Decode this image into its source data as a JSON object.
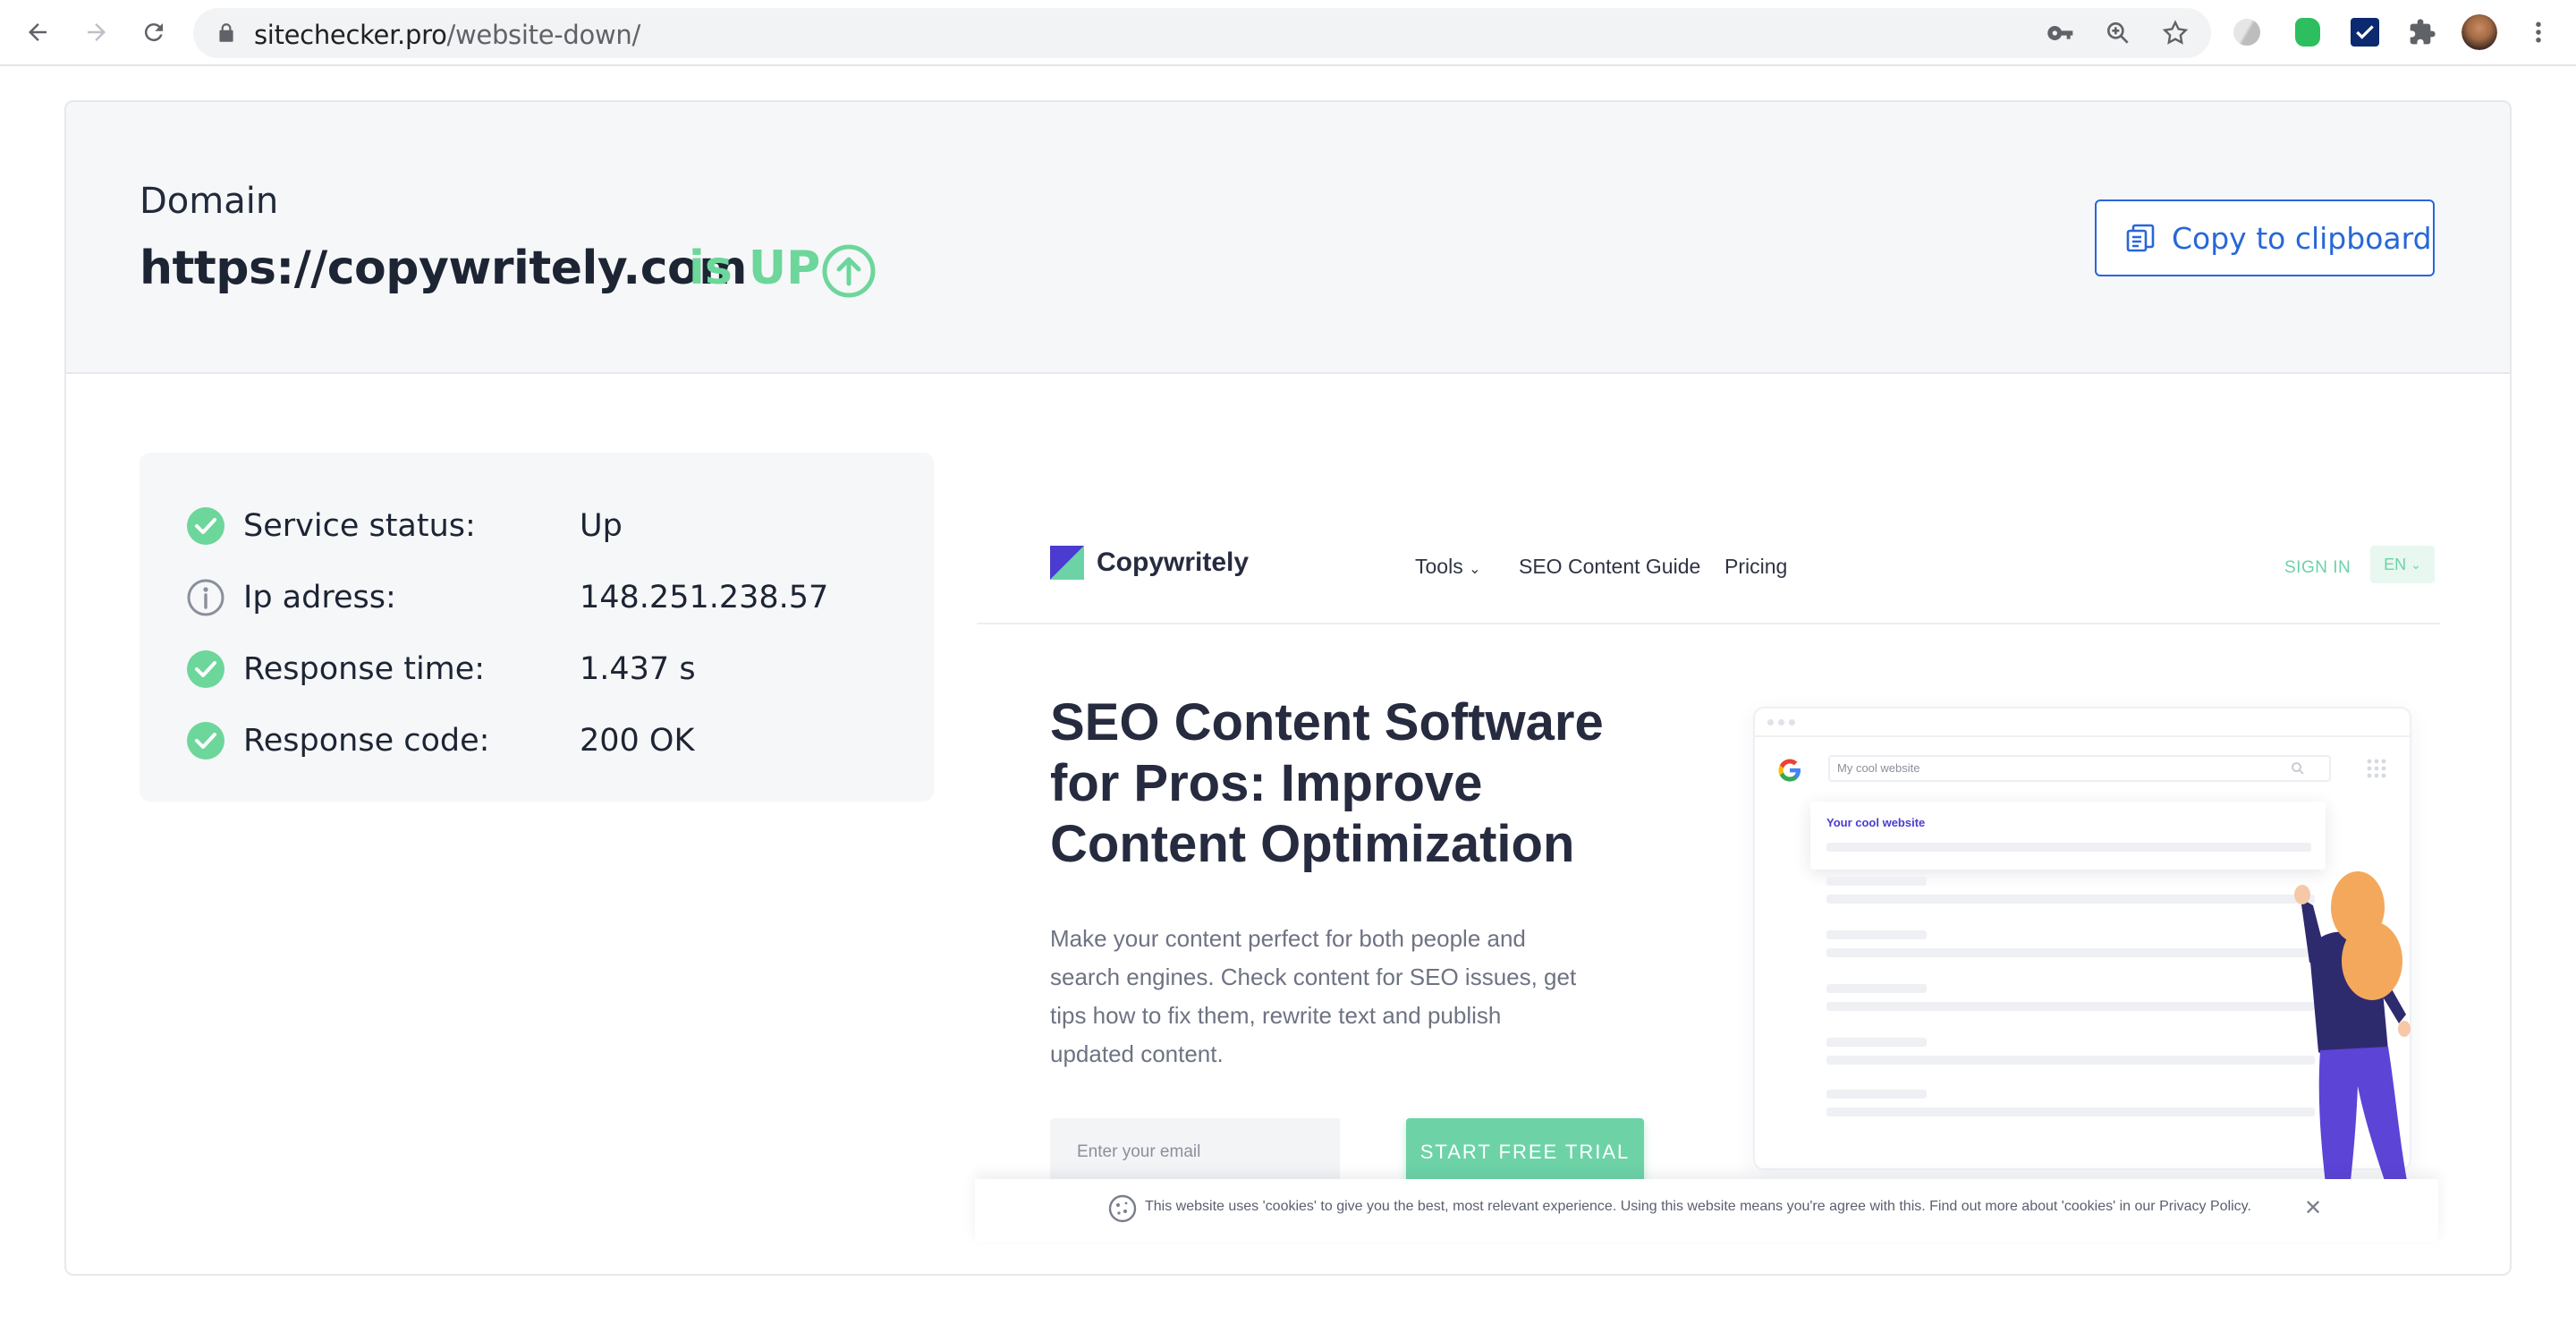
{
  "browser": {
    "url_domain": "sitechecker.pro",
    "url_path": "/website-down/"
  },
  "header": {
    "domain_label": "Domain",
    "domain_url": "https://copywritely.com",
    "status_text": "is UP",
    "copy_label": "Copy to clipboard"
  },
  "info": {
    "rows": [
      {
        "label": "Service status:",
        "value": "Up",
        "icon": "check-circle-icon"
      },
      {
        "label": "Ip adress:",
        "value": "148.251.238.57",
        "icon": "info-circle-icon"
      },
      {
        "label": "Response time:",
        "value": "1.437 s",
        "icon": "check-circle-icon"
      },
      {
        "label": "Response code:",
        "value": "200 OK",
        "icon": "check-circle-icon"
      }
    ]
  },
  "preview": {
    "brand": "Copywritely",
    "nav": [
      "Tools",
      "SEO Content Guide",
      "Pricing"
    ],
    "signin": "SIGN IN",
    "lang": "EN",
    "headline": [
      "SEO Content Software",
      "for Pros: Improve",
      "Content Optimization"
    ],
    "description": [
      "Make your content perfect for both people and",
      "search engines. Check content for SEO issues, get",
      "tips how to fix them, rewrite text and publish",
      "updated content."
    ],
    "email_placeholder": "Enter your email",
    "trial_button": "START FREE TRIAL",
    "mock_search": "My cool website",
    "mock_result": "Your cool website"
  },
  "cookie": {
    "text": "This website uses 'cookies' to give you the best, most relevant experience. Using this website means you're agree with this. Find out more about 'cookies' in our Privacy Policy.",
    "close": "✕"
  },
  "colors": {
    "up_green": "#6dd69b",
    "link_blue": "#2767d8",
    "brand_mint": "#6dd3a7",
    "headline": "#262b3f"
  }
}
